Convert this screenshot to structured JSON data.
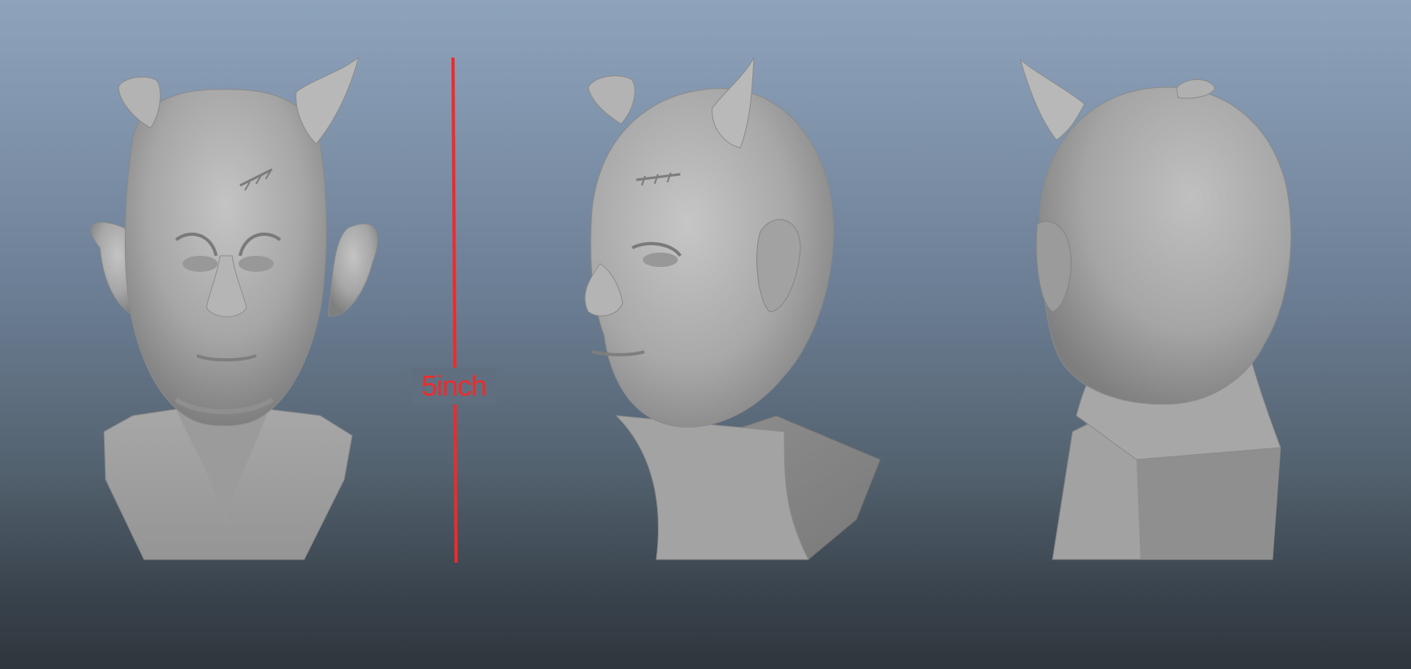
{
  "viewport": {
    "background_top": "#8ea3bc",
    "background_bottom": "#2f363d",
    "model_color": "#a9a9a9"
  },
  "measurement": {
    "label": "5inch",
    "color": "#ee2b2b"
  },
  "views": [
    {
      "name": "front"
    },
    {
      "name": "three-quarter"
    },
    {
      "name": "back"
    }
  ]
}
